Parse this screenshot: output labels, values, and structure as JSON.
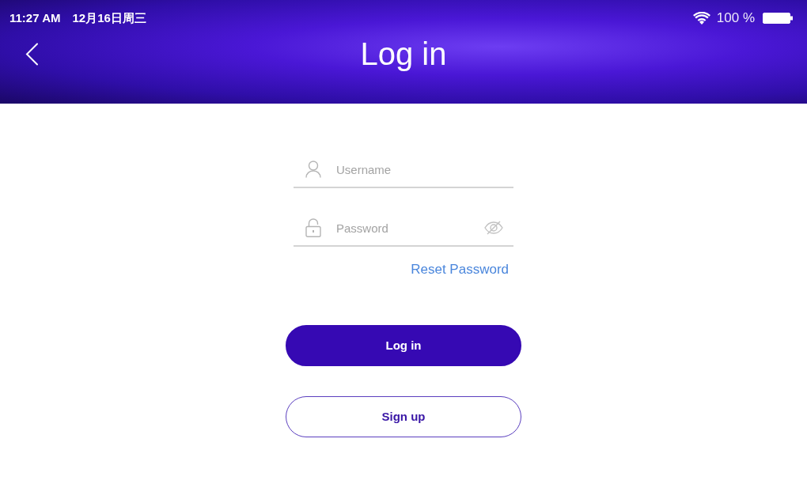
{
  "status_bar": {
    "time": "11:27 AM",
    "date": "12月16日周三",
    "battery": "100 %"
  },
  "header": {
    "title": "Log in"
  },
  "form": {
    "fields": [
      {
        "kind": "username",
        "placeholder": "Username"
      },
      {
        "kind": "password",
        "placeholder": "Password"
      }
    ],
    "reset_link": "Reset Password"
  },
  "buttons": [
    {
      "kind": "primary",
      "label": "Log in"
    },
    {
      "kind": "outline",
      "label": "Sign up"
    }
  ]
}
